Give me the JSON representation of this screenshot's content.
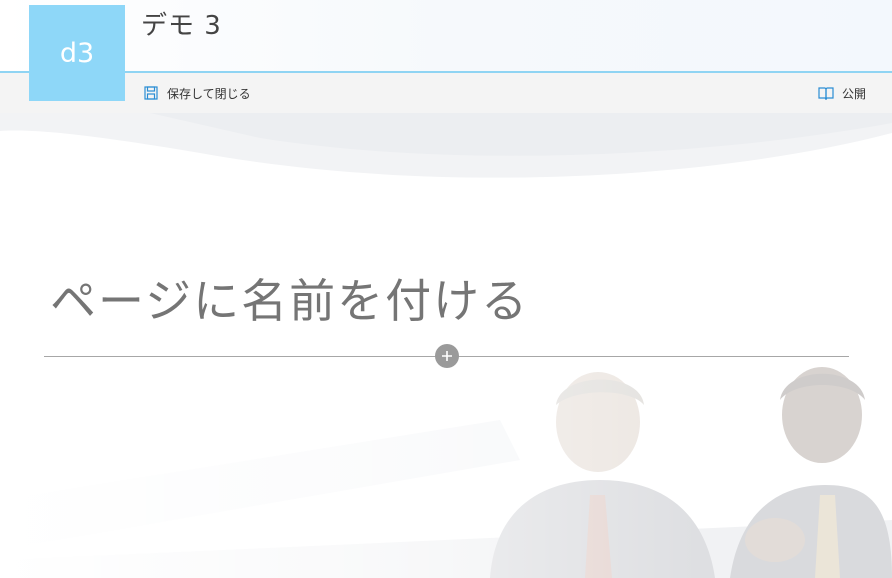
{
  "header": {
    "logo_text": "d3",
    "site_title": "デモ 3",
    "accent_color": "#8ed7f8"
  },
  "command_bar": {
    "save_close_label": "保存して閉じる",
    "save_icon": "save-icon",
    "publish_label": "公開",
    "publish_icon": "book-icon"
  },
  "page": {
    "title_placeholder": "ページに名前を付ける",
    "title_value": "",
    "add_section_icon": "plus-icon"
  }
}
